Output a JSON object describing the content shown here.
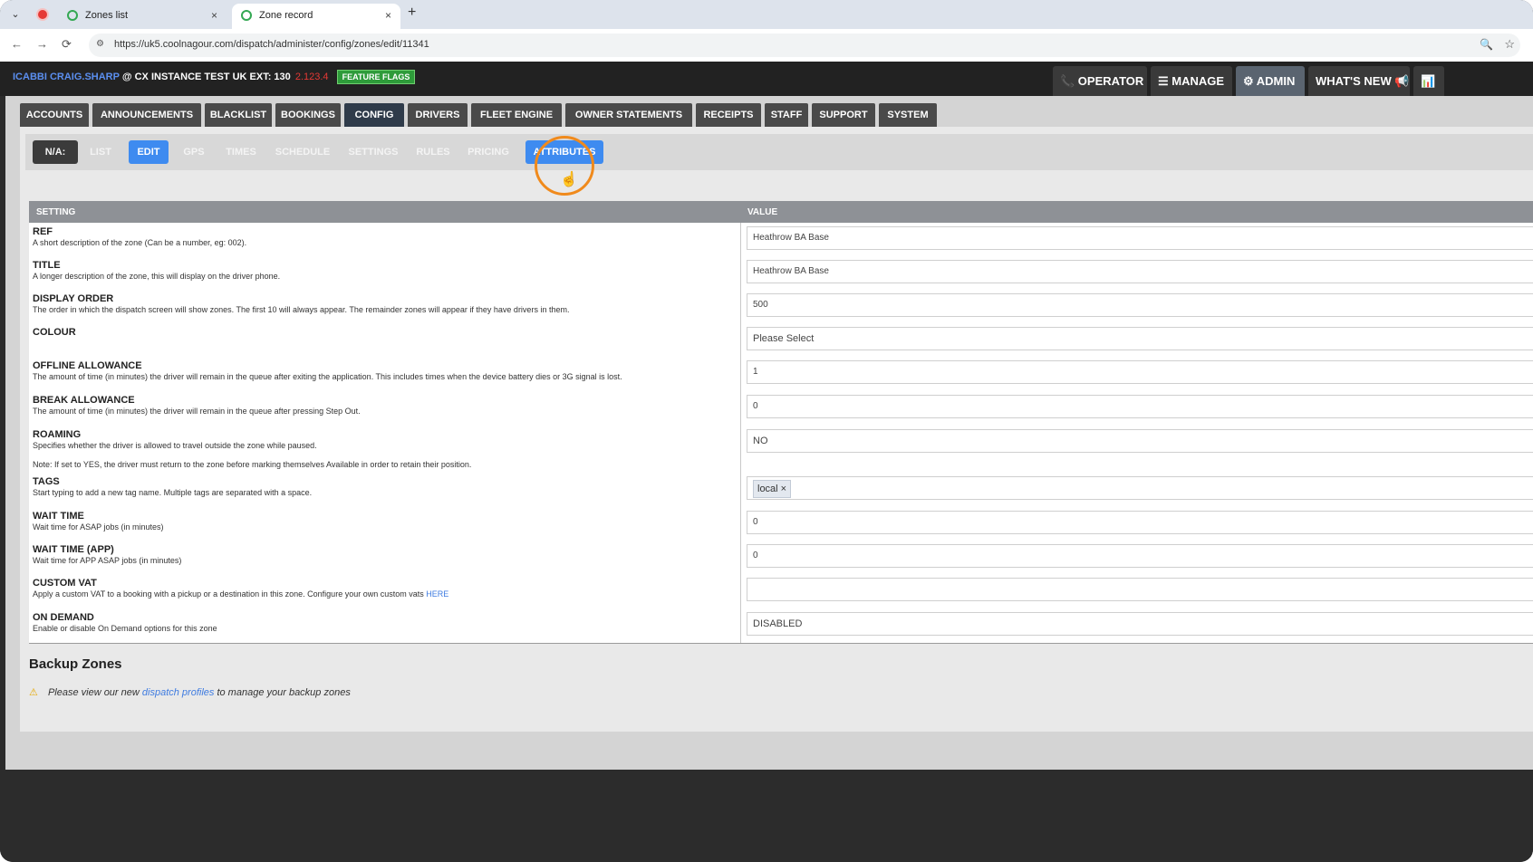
{
  "browser": {
    "tabs": [
      {
        "label": "Zones list",
        "close": "×"
      },
      {
        "label": "Zone record",
        "close": "×"
      }
    ],
    "new_tab": "+",
    "url": "https://uk5.coolnagour.com/dispatch/administer/config/zones/edit/11341",
    "nav": {
      "back": "←",
      "forward": "→",
      "reload": "⟳"
    }
  },
  "header": {
    "user": "ICABBI CRAIG.SHARP",
    "instance": "@ CX INSTANCE TEST UK EXT: 130",
    "build": "2.123.4",
    "feature_flags": "FEATURE FLAGS",
    "right_nav": [
      {
        "label": "📞 OPERATOR"
      },
      {
        "label": "☰ MANAGE"
      },
      {
        "label": "⚙ ADMIN"
      },
      {
        "label": "WHAT'S NEW 📢"
      },
      {
        "label": "📊"
      }
    ]
  },
  "main_tabs": [
    "ACCOUNTS",
    "ANNOUNCEMENTS",
    "BLACKLIST",
    "BOOKINGS",
    "CONFIG",
    "DRIVERS",
    "FLEET ENGINE",
    "OWNER STATEMENTS",
    "RECEIPTS",
    "STAFF",
    "SUPPORT",
    "SYSTEM"
  ],
  "sub_tabs": [
    "N/A:",
    "LIST",
    "EDIT",
    "GPS",
    "TIMES",
    "SCHEDULE",
    "SETTINGS",
    "RULES",
    "PRICING",
    "ATTRIBUTES"
  ],
  "table": {
    "col_setting": "SETTING",
    "col_value": "VALUE",
    "rows": [
      {
        "name": "REF",
        "desc": "A short description of the zone (Can be a number, eg: 002).",
        "value": "Heathrow BA Base"
      },
      {
        "name": "TITLE",
        "desc": "A longer description of the zone, this will display on the driver phone.",
        "value": "Heathrow BA Base"
      },
      {
        "name": "DISPLAY ORDER",
        "desc": "The order in which the dispatch screen will show zones. The first 10 will always appear. The remainder zones will appear if they have drivers in them.",
        "value": "500"
      },
      {
        "name": "COLOUR",
        "desc": "",
        "value": "Please Select"
      },
      {
        "name": "OFFLINE ALLOWANCE",
        "desc": "The amount of time (in minutes) the driver will remain in the queue after exiting the application. This includes times when the device battery dies or 3G signal is lost.",
        "value": "1"
      },
      {
        "name": "BREAK ALLOWANCE",
        "desc": "The amount of time (in minutes) the driver will remain in the queue after pressing Step Out.",
        "value": "0"
      },
      {
        "name": "ROAMING",
        "desc": "Specifies whether the driver is allowed to travel outside the zone while paused.",
        "note": "Note: If set to YES, the driver must return to the zone before marking themselves Available in order to retain their position.",
        "value": "NO"
      },
      {
        "name": "TAGS",
        "desc": "Start typing to add a new tag name. Multiple tags are separated with a space.",
        "value": "local ×"
      },
      {
        "name": "WAIT TIME",
        "desc": "Wait time for ASAP jobs (in minutes)",
        "value": "0"
      },
      {
        "name": "WAIT TIME (APP)",
        "desc": "Wait time for APP ASAP jobs (in minutes)",
        "value": "0"
      },
      {
        "name": "CUSTOM VAT",
        "desc": "Apply a custom VAT to a booking with a pickup or a destination in this zone. Configure your own custom vats",
        "link": "HERE",
        "value": ""
      },
      {
        "name": "ON DEMAND",
        "desc": "Enable or disable On Demand options for this zone",
        "value": "DISABLED"
      }
    ]
  },
  "backup": {
    "title": "Backup Zones",
    "note_pre": "Please view our new",
    "note_link": "dispatch profiles",
    "note_post": "to manage your backup zones"
  }
}
